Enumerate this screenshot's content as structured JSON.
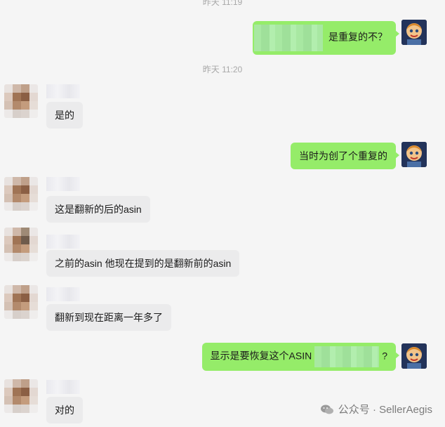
{
  "chat": {
    "timestamps": [
      "昨天 11:19",
      "昨天 11:20"
    ],
    "messages": [
      {
        "side": "out",
        "text": "是重复的不？"
      },
      {
        "side": "in",
        "text": "是的"
      },
      {
        "side": "out",
        "text": "当时为创了个重复的"
      },
      {
        "side": "in",
        "text": "这是翻新的后的asin"
      },
      {
        "side": "in",
        "text": "之前的asin 他现在提到的是翻新前的asin"
      },
      {
        "side": "in",
        "text": "翻新到现在距离一年多了"
      },
      {
        "side": "out",
        "text_before": "显示是要恢复这个ASIN",
        "text_after": "?"
      },
      {
        "side": "in",
        "text": "对的"
      }
    ]
  },
  "watermark": {
    "icon": "wechat-icon",
    "text": "公众号 · SellerAegis"
  },
  "colors": {
    "out_bubble": "#95ec69",
    "in_bubble": "#ebebec",
    "background": "#f5f5f5"
  }
}
